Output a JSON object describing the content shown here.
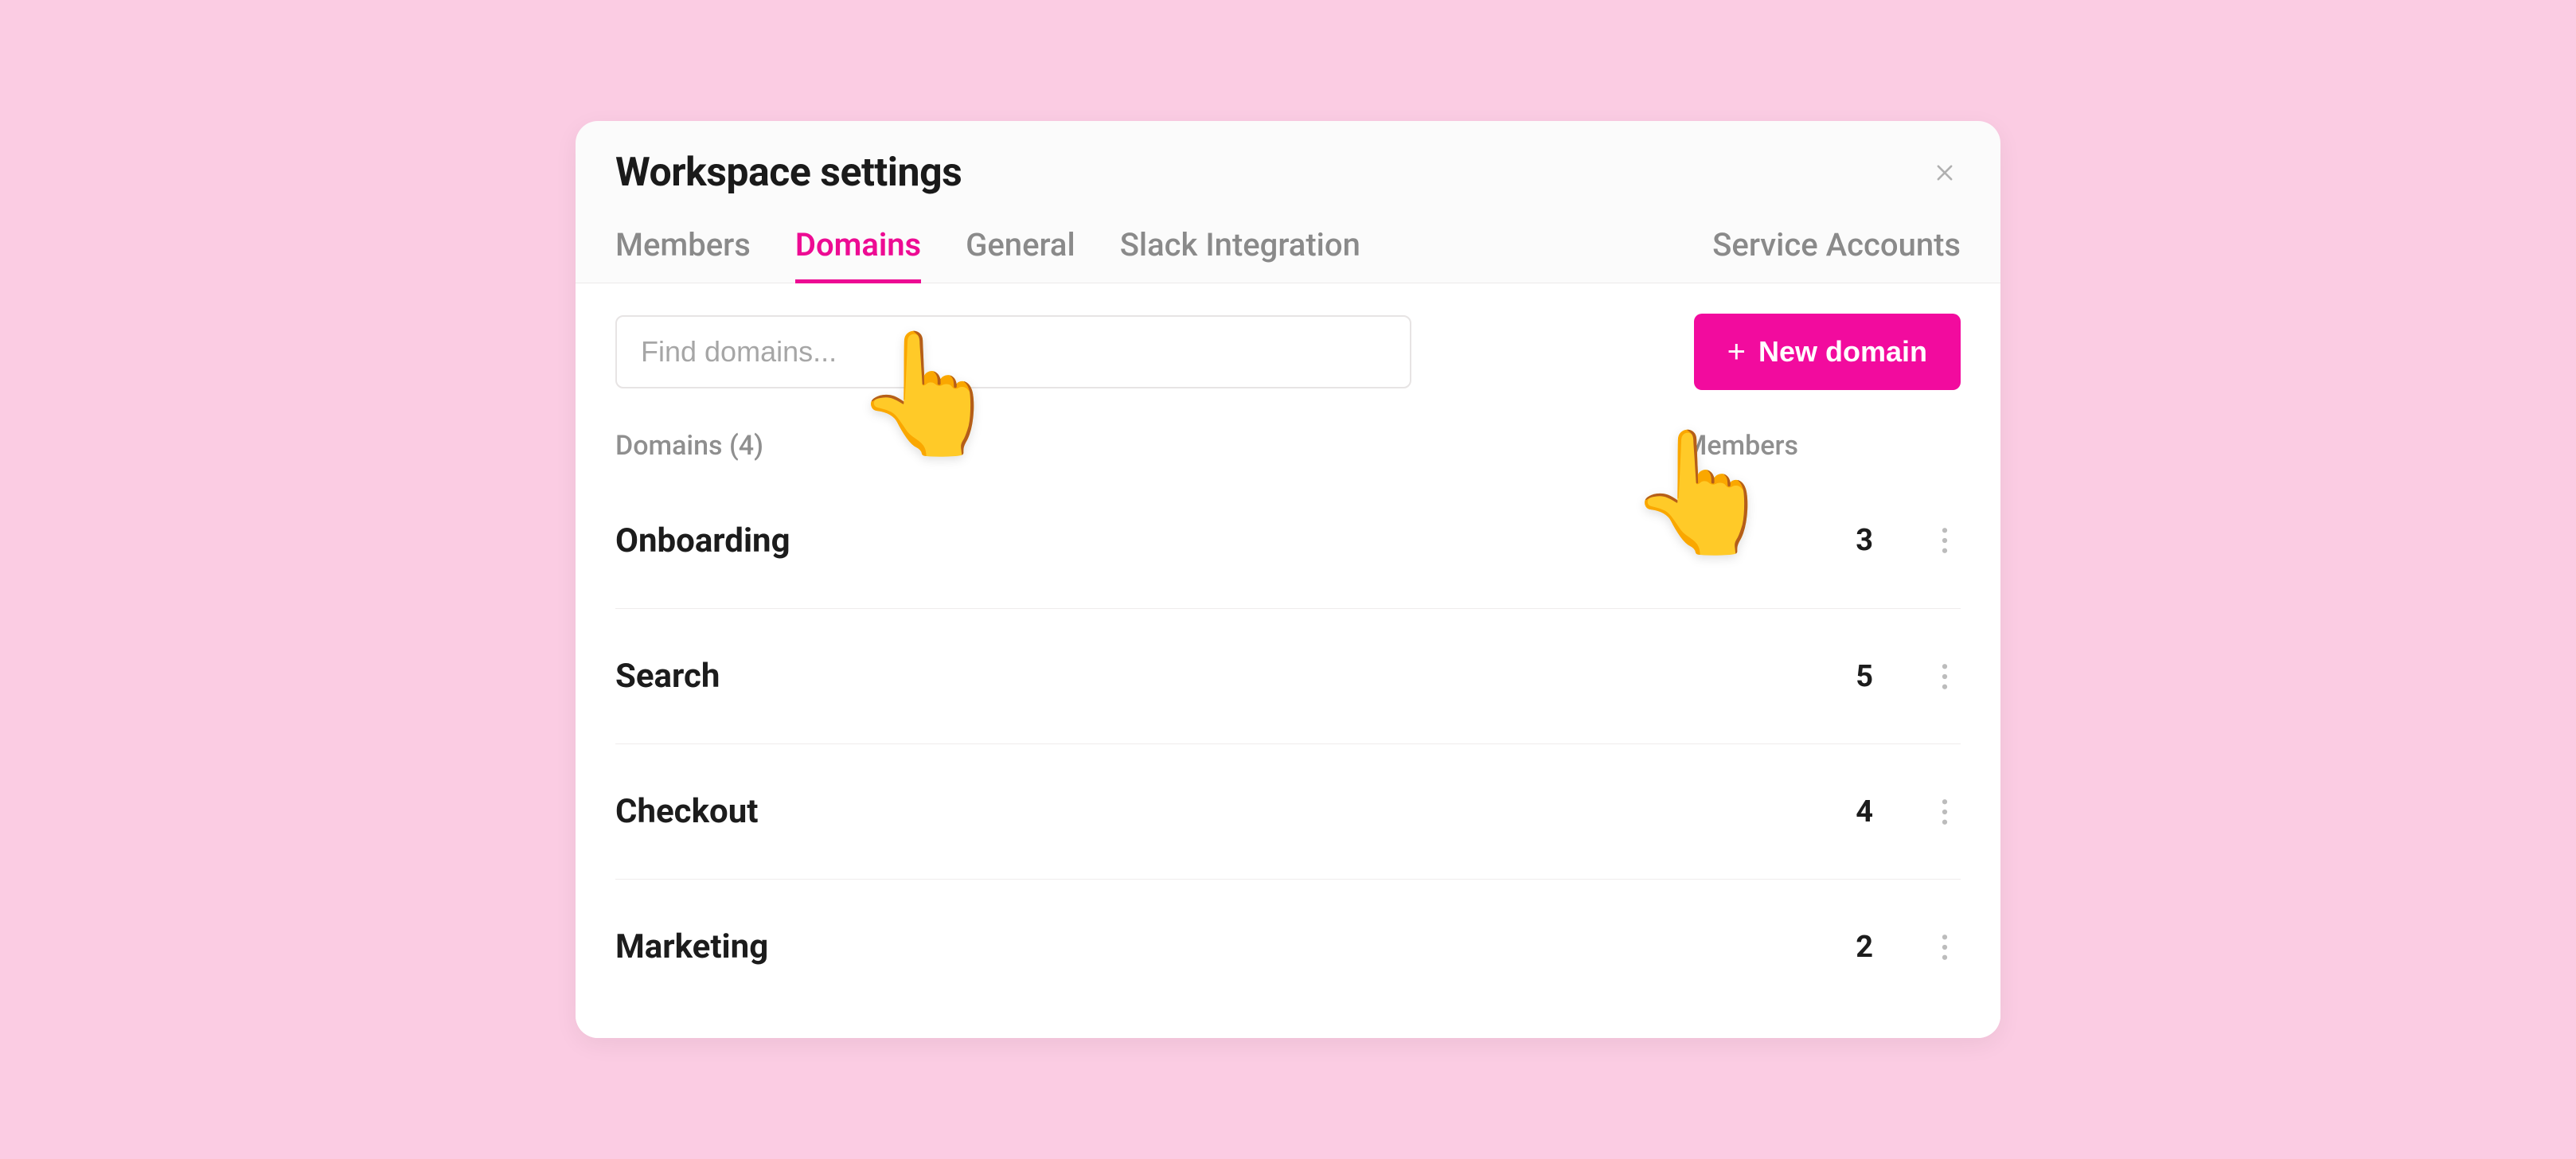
{
  "modal": {
    "title": "Workspace settings"
  },
  "tabs": [
    {
      "label": "Members",
      "active": false,
      "right": false
    },
    {
      "label": "Domains",
      "active": true,
      "right": false
    },
    {
      "label": "General",
      "active": false,
      "right": false
    },
    {
      "label": "Slack Integration",
      "active": false,
      "right": false
    },
    {
      "label": "Service Accounts",
      "active": false,
      "right": true
    }
  ],
  "search": {
    "placeholder": "Find domains..."
  },
  "new_button": {
    "label": "New domain"
  },
  "columns": {
    "domains": "Domains (4)",
    "members": "Members"
  },
  "rows": [
    {
      "name": "Onboarding",
      "members": "3"
    },
    {
      "name": "Search",
      "members": "5"
    },
    {
      "name": "Checkout",
      "members": "4"
    },
    {
      "name": "Marketing",
      "members": "2"
    }
  ],
  "pointer_glyph": "👆"
}
